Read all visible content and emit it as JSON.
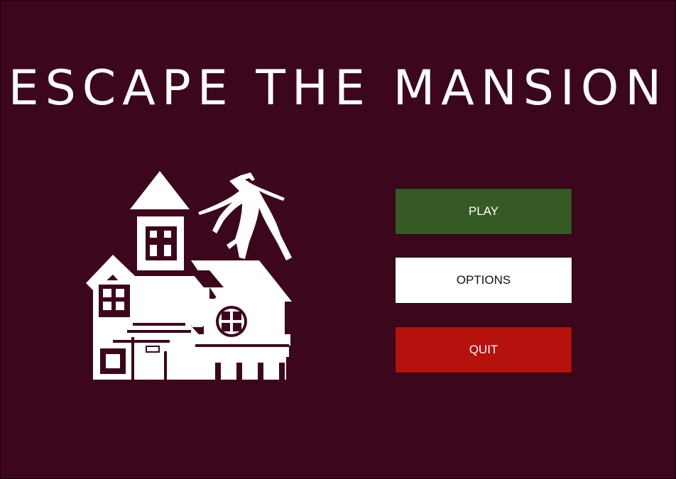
{
  "game": {
    "title": "ESCAPE THE MANSION"
  },
  "menu": {
    "play_label": "PLAY",
    "options_label": "OPTIONS",
    "quit_label": "QUIT"
  },
  "colors": {
    "background": "#3c061d",
    "play_button": "#365a24",
    "options_button": "#ffffff",
    "quit_button": "#b5110d",
    "art": "#ffffff"
  },
  "icons": {
    "mansion": "haunted-mansion-icon"
  }
}
